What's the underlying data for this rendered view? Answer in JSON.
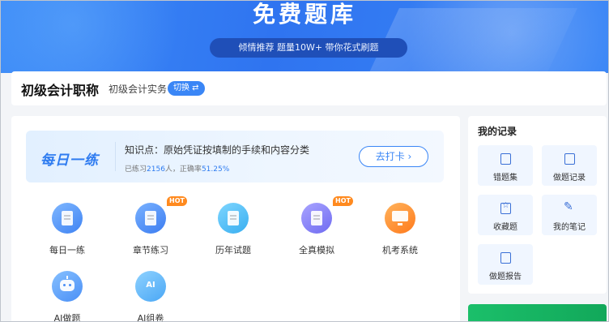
{
  "banner": {
    "title": "免费题库",
    "tagline": "倾情推荐 题量10W+ 带你花式刷题"
  },
  "subject": {
    "title": "初级会计职称",
    "current": "初级会计实务",
    "switch_label": "切换 ⇄"
  },
  "daily": {
    "logo": "每日一练",
    "knowledge_point": "知识点：原始凭证按填制的手续和内容分类",
    "stats_prefix": "已练习",
    "practiced": "2156",
    "stats_mid": "人，正确率",
    "accuracy": "51.25%",
    "punch_label": "去打卡 ›"
  },
  "features": [
    {
      "label": "每日一练",
      "icon": "daily-practice-icon",
      "hot": false
    },
    {
      "label": "章节练习",
      "icon": "chapter-practice-icon",
      "hot": true,
      "hot_label": "HOT"
    },
    {
      "label": "历年试题",
      "icon": "past-exams-icon",
      "hot": false
    },
    {
      "label": "全真模拟",
      "icon": "mock-exam-icon",
      "hot": true,
      "hot_label": "HOT"
    },
    {
      "label": "机考系统",
      "icon": "computer-exam-icon",
      "hot": false
    },
    {
      "label": "AI做题",
      "icon": "robot-icon",
      "hot": false
    },
    {
      "label": "AI组卷",
      "icon": "ai-paper-icon",
      "hot": false,
      "glyph": "AI"
    }
  ],
  "records": {
    "title": "我的记录",
    "items": [
      {
        "label": "错题集",
        "icon": "wrong-answers-icon"
      },
      {
        "label": "做题记录",
        "icon": "history-icon"
      },
      {
        "label": "收藏题",
        "icon": "favorites-icon"
      },
      {
        "label": "我的笔记",
        "icon": "notes-icon"
      },
      {
        "label": "做题报告",
        "icon": "report-icon"
      }
    ]
  },
  "colors": {
    "primary": "#3a86f6",
    "hot": "#ff8a1f",
    "green": "#1bbf6a"
  }
}
